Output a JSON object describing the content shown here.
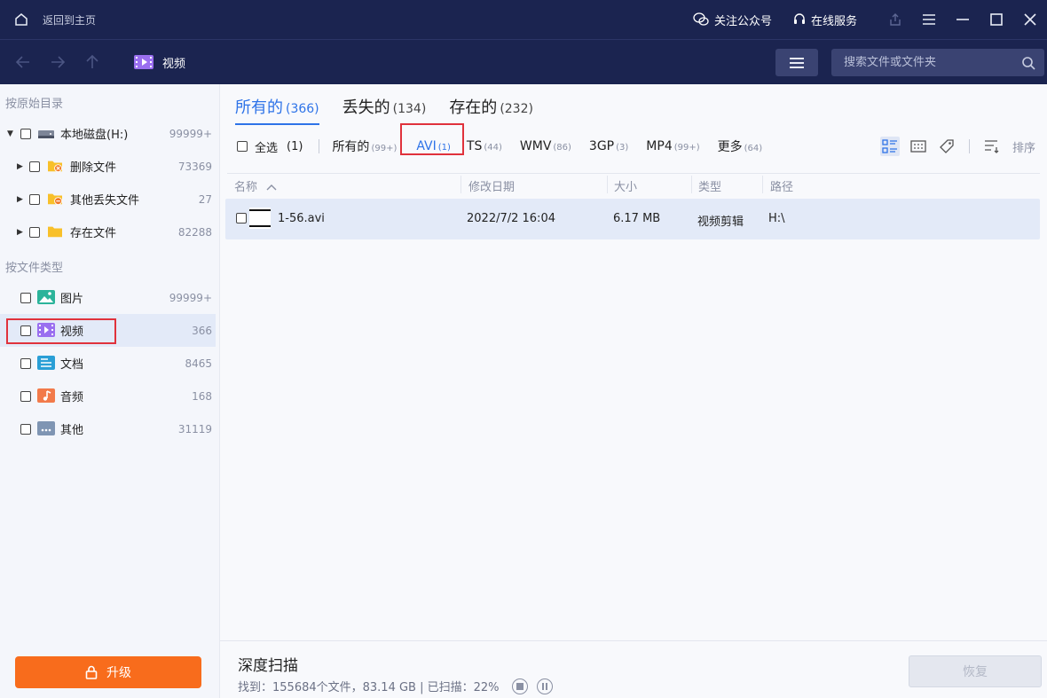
{
  "titlebar": {
    "home_label": "返回到主页",
    "follow_label": "关注公众号",
    "service_label": "在线服务"
  },
  "navbar": {
    "crumb_label": "视频",
    "search_placeholder": "搜索文件或文件夹"
  },
  "sidebar": {
    "section_path": "按原始目录",
    "section_type": "按文件类型",
    "disk": {
      "label": "本地磁盘(H:)",
      "count": "99999+"
    },
    "folders": [
      {
        "label": "删除文件",
        "count": "73369"
      },
      {
        "label": "其他丢失文件",
        "count": "27"
      },
      {
        "label": "存在文件",
        "count": "82288"
      }
    ],
    "types": [
      {
        "label": "图片",
        "count": "99999+",
        "icon": "image-icon"
      },
      {
        "label": "视频",
        "count": "366",
        "icon": "video-icon"
      },
      {
        "label": "文档",
        "count": "8465",
        "icon": "document-icon"
      },
      {
        "label": "音频",
        "count": "168",
        "icon": "audio-icon"
      },
      {
        "label": "其他",
        "count": "31119",
        "icon": "other-icon"
      }
    ],
    "upgrade_label": "升级"
  },
  "tabs": [
    {
      "label": "所有的",
      "count": "(366)"
    },
    {
      "label": "丢失的",
      "count": "(134)"
    },
    {
      "label": "存在的",
      "count": "(232)"
    }
  ],
  "filters": {
    "select_all": "全选",
    "select_count": "(1)",
    "items": [
      {
        "label": "所有的",
        "count": "(99+)"
      },
      {
        "label": "AVI",
        "count": "(1)"
      },
      {
        "label": "TS",
        "count": "(44)"
      },
      {
        "label": "WMV",
        "count": "(86)"
      },
      {
        "label": "3GP",
        "count": "(3)"
      },
      {
        "label": "MP4",
        "count": "(99+)"
      },
      {
        "label": "更多",
        "count": "(64)"
      }
    ],
    "sort_label": "排序"
  },
  "table": {
    "columns": [
      "名称",
      "修改日期",
      "大小",
      "类型",
      "路径"
    ],
    "rows": [
      {
        "name": "1-56.avi",
        "date": "2022/7/2 16:04",
        "size": "6.17 MB",
        "type": "视频剪辑",
        "path": "H:\\"
      }
    ]
  },
  "status": {
    "title": "深度扫描",
    "info": "找到：155684个文件，83.14 GB | 已扫描：22%",
    "recover_label": "恢复"
  },
  "colors": {
    "titlebar": "#1b2450",
    "accent": "#2e73e8",
    "upgrade": "#f86c1c",
    "highlight": "#e0323c"
  }
}
